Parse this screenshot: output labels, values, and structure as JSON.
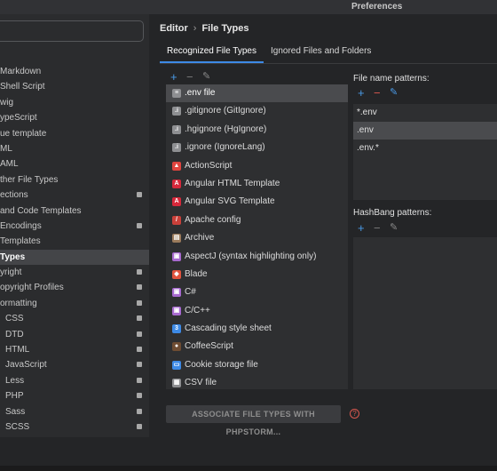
{
  "window": {
    "title": "Preferences"
  },
  "breadcrumb": {
    "parent": "Editor",
    "separator": "›",
    "current": "File Types"
  },
  "tabs": [
    {
      "label": "Recognized File Types"
    },
    {
      "label": "Ignored Files and Folders"
    }
  ],
  "sidebar": {
    "items": [
      {
        "label": "Markdown"
      },
      {
        "label": "Shell Script"
      },
      {
        "label": "wig"
      },
      {
        "label": "ypeScript"
      },
      {
        "label": "ue template"
      },
      {
        "label": "ML"
      },
      {
        "label": "AML"
      },
      {
        "label": "ther File Types"
      },
      {
        "label": "ections"
      },
      {
        "label": "and Code Templates"
      },
      {
        "label": "Encodings"
      },
      {
        "label": "Templates"
      },
      {
        "label": "Types"
      },
      {
        "label": "yright"
      },
      {
        "label": "opyright Profiles"
      },
      {
        "label": "ormatting"
      },
      {
        "label": "CSS"
      },
      {
        "label": "DTD"
      },
      {
        "label": "HTML"
      },
      {
        "label": "JavaScript"
      },
      {
        "label": "Less"
      },
      {
        "label": "PHP"
      },
      {
        "label": "Sass"
      },
      {
        "label": "SCSS"
      }
    ]
  },
  "file_types": [
    {
      "label": ".env file",
      "icon": "text-file-icon",
      "color": "#8e8f92"
    },
    {
      "label": ".gitignore (GitIgnore)",
      "icon": "ignore-file-icon",
      "color": "#8e8f92"
    },
    {
      "label": ".hgignore (HgIgnore)",
      "icon": "ignore-file-icon",
      "color": "#8e8f92"
    },
    {
      "label": ".ignore (IgnoreLang)",
      "icon": "ignore-file-icon",
      "color": "#8e8f92"
    },
    {
      "label": "ActionScript",
      "icon": "actionscript-icon",
      "color": "#e0443e"
    },
    {
      "label": "Angular HTML Template",
      "icon": "angular-icon",
      "color": "#d6283b"
    },
    {
      "label": "Angular SVG Template",
      "icon": "angular-icon",
      "color": "#d6283b"
    },
    {
      "label": "Apache config",
      "icon": "apache-feather-icon",
      "color": "#c9403a"
    },
    {
      "label": "Archive",
      "icon": "archive-icon",
      "color": "#9b7b5c"
    },
    {
      "label": "AspectJ (syntax highlighting only)",
      "icon": "aspectj-icon",
      "color": "#a86ad0"
    },
    {
      "label": "Blade",
      "icon": "blade-icon",
      "color": "#e2533d"
    },
    {
      "label": "C#",
      "icon": "csharp-icon",
      "color": "#a86ad0"
    },
    {
      "label": "C/C++",
      "icon": "cpp-icon",
      "color": "#a86ad0"
    },
    {
      "label": "Cascading style sheet",
      "icon": "css-icon",
      "color": "#3d8ae6"
    },
    {
      "label": "CoffeeScript",
      "icon": "coffeescript-icon",
      "color": "#6e4c32"
    },
    {
      "label": "Cookie storage file",
      "icon": "cookie-file-icon",
      "color": "#3d8ae6"
    },
    {
      "label": "CSV file",
      "icon": "csv-file-icon",
      "color": "#8e8f92"
    }
  ],
  "file_name_patterns": {
    "label": "File name patterns:",
    "items": [
      "*.env",
      ".env",
      ".env.*"
    ]
  },
  "hashbang_patterns": {
    "label": "HashBang patterns:",
    "items": []
  },
  "toolbar": {
    "add": "+",
    "remove": "−",
    "edit": "✎"
  },
  "footer": {
    "associate_button": "ASSOCIATE FILE TYPES WITH PHPSTORM...",
    "help": "?"
  },
  "colors": {
    "accent": "#3d8ae6",
    "selection": "#4a4b4e",
    "panel": "#2e2f31",
    "background": "#242527"
  }
}
